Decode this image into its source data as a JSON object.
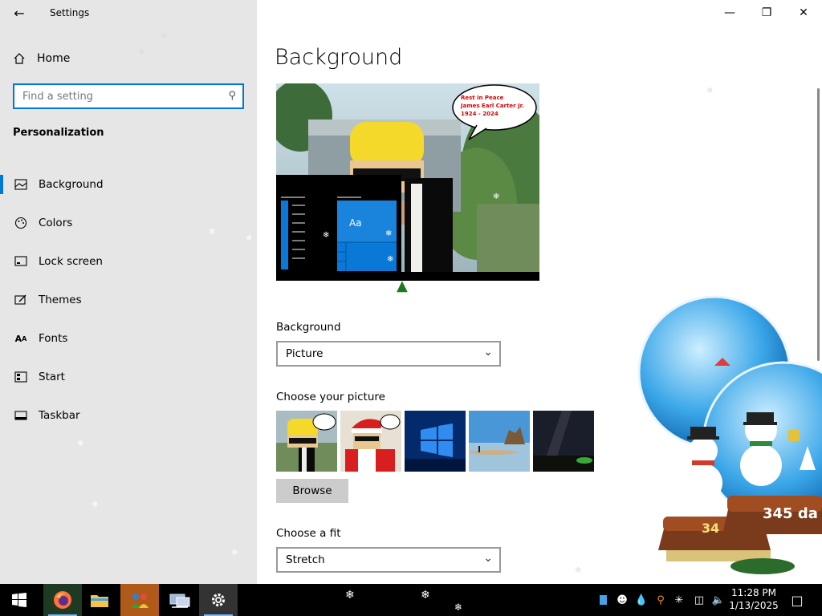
{
  "window": {
    "title": "Settings",
    "back_icon": "back-arrow-icon",
    "controls": {
      "minimize": "minimize-icon",
      "restore": "restore-icon",
      "close": "close-icon"
    }
  },
  "sidebar": {
    "home_label": "Home",
    "search_placeholder": "Find a setting",
    "section_title": "Personalization",
    "items": [
      {
        "label": "Background",
        "icon": "picture-icon",
        "active": true
      },
      {
        "label": "Colors",
        "icon": "palette-icon",
        "active": false
      },
      {
        "label": "Lock screen",
        "icon": "lock-screen-icon",
        "active": false
      },
      {
        "label": "Themes",
        "icon": "themes-icon",
        "active": false
      },
      {
        "label": "Fonts",
        "icon": "fonts-icon",
        "active": false
      },
      {
        "label": "Start",
        "icon": "start-icon",
        "active": false
      },
      {
        "label": "Taskbar",
        "icon": "taskbar-icon",
        "active": false
      }
    ]
  },
  "main": {
    "page_title": "Background",
    "preview": {
      "tile_label": "Aa",
      "speech_line1": "Rest in Peace",
      "speech_line2": "James Earl Carter Jr.",
      "speech_line3": "1924 - 2024"
    },
    "background_label": "Background",
    "background_value": "Picture",
    "choose_picture_label": "Choose your picture",
    "browse_label": "Browse",
    "choose_fit_label": "Choose a fit",
    "fit_value": "Stretch"
  },
  "desktop_overlay": {
    "globe_text_1": "345 da",
    "globe_text_2": "34"
  },
  "taskbar": {
    "apps": [
      "windows-start-icon",
      "firefox-icon",
      "file-explorer-icon",
      "people-app-icon",
      "network-app-icon",
      "settings-gear-icon"
    ],
    "time": "11:28 PM",
    "date": "1/13/2025"
  },
  "colors": {
    "accent": "#0078d7",
    "sidebar_bg": "#e6e6e6",
    "taskbar_bg": "#000000"
  }
}
